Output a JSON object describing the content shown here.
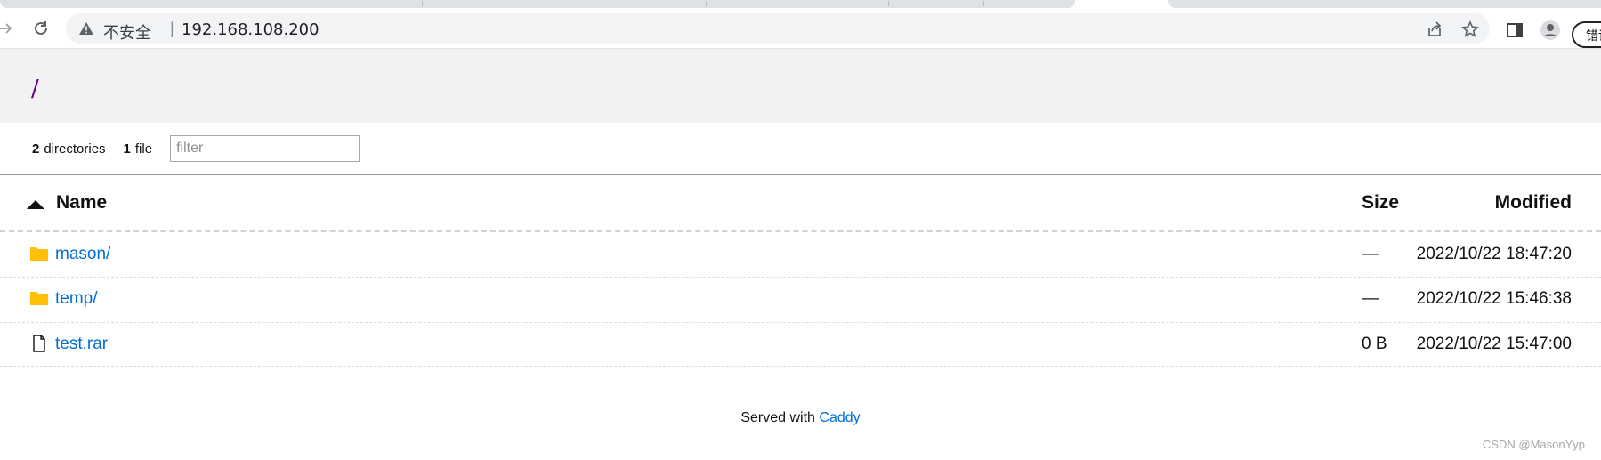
{
  "browser": {
    "security_label": "不安全",
    "url": "192.168.108.200",
    "profile_label": "错误"
  },
  "listing": {
    "path": "/",
    "summary": {
      "dir_count": "2",
      "dir_label": "directories",
      "file_count": "1",
      "file_label": "file"
    },
    "filter": {
      "placeholder": "filter",
      "value": ""
    },
    "columns": {
      "name": "Name",
      "size": "Size",
      "modified": "Modified"
    },
    "sort": {
      "column": "name",
      "direction": "ascending"
    },
    "entries": [
      {
        "name": "mason/",
        "type": "folder",
        "size": "—",
        "modified": "2022/10/22 18:47:20"
      },
      {
        "name": "temp/",
        "type": "folder",
        "size": "—",
        "modified": "2022/10/22 15:46:38"
      },
      {
        "name": "test.rar",
        "type": "file",
        "size": "0 B",
        "modified": "2022/10/22 15:47:00"
      }
    ]
  },
  "footer": {
    "text": "Served with",
    "link": "Caddy"
  },
  "watermark": "CSDN @MasonYyp",
  "colors": {
    "link": "#006ed3",
    "header_bg": "#f2f2f2",
    "path": "#660099",
    "folder": "#ffc107"
  }
}
